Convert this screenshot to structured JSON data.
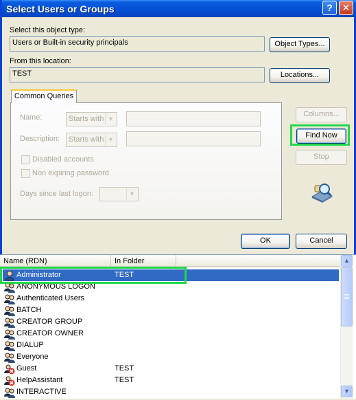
{
  "window": {
    "title": "Select Users or Groups"
  },
  "object_type": {
    "label": "Select this object type:",
    "value": "Users or Built-in security principals",
    "button": "Object Types..."
  },
  "location": {
    "label": "From this location:",
    "value": "TEST",
    "button": "Locations..."
  },
  "tab": {
    "label": "Common Queries"
  },
  "queries": {
    "name_label": "Name:",
    "name_mode": "Starts with",
    "description_label": "Description:",
    "description_mode": "Starts with",
    "disabled_accounts": "Disabled accounts",
    "non_expiring_password": "Non expiring password",
    "days_since_logon": "Days since last logon:"
  },
  "buttons": {
    "columns": "Columns...",
    "find_now": "Find Now",
    "stop": "Stop",
    "ok": "OK",
    "cancel": "Cancel"
  },
  "results": {
    "columns": [
      "Name (RDN)",
      "In Folder"
    ],
    "rows": [
      {
        "name": "Administrator",
        "folder": "TEST",
        "icon": "user-icon",
        "selected": true
      },
      {
        "name": "ANONYMOUS LOGON",
        "folder": "",
        "icon": "group-icon"
      },
      {
        "name": "Authenticated Users",
        "folder": "",
        "icon": "group-icon"
      },
      {
        "name": "BATCH",
        "folder": "",
        "icon": "group-icon"
      },
      {
        "name": "CREATOR GROUP",
        "folder": "",
        "icon": "group-icon"
      },
      {
        "name": "CREATOR OWNER",
        "folder": "",
        "icon": "group-icon"
      },
      {
        "name": "DIALUP",
        "folder": "",
        "icon": "group-icon"
      },
      {
        "name": "Everyone",
        "folder": "",
        "icon": "group-icon"
      },
      {
        "name": "Guest",
        "folder": "TEST",
        "icon": "disabled-user-icon"
      },
      {
        "name": "HelpAssistant",
        "folder": "TEST",
        "icon": "disabled-user-icon"
      },
      {
        "name": "INTERACTIVE",
        "folder": "",
        "icon": "group-icon"
      }
    ]
  },
  "colors": {
    "titlebar": "#0550D8",
    "highlight": "#22D84A",
    "selection": "#316AC5"
  }
}
